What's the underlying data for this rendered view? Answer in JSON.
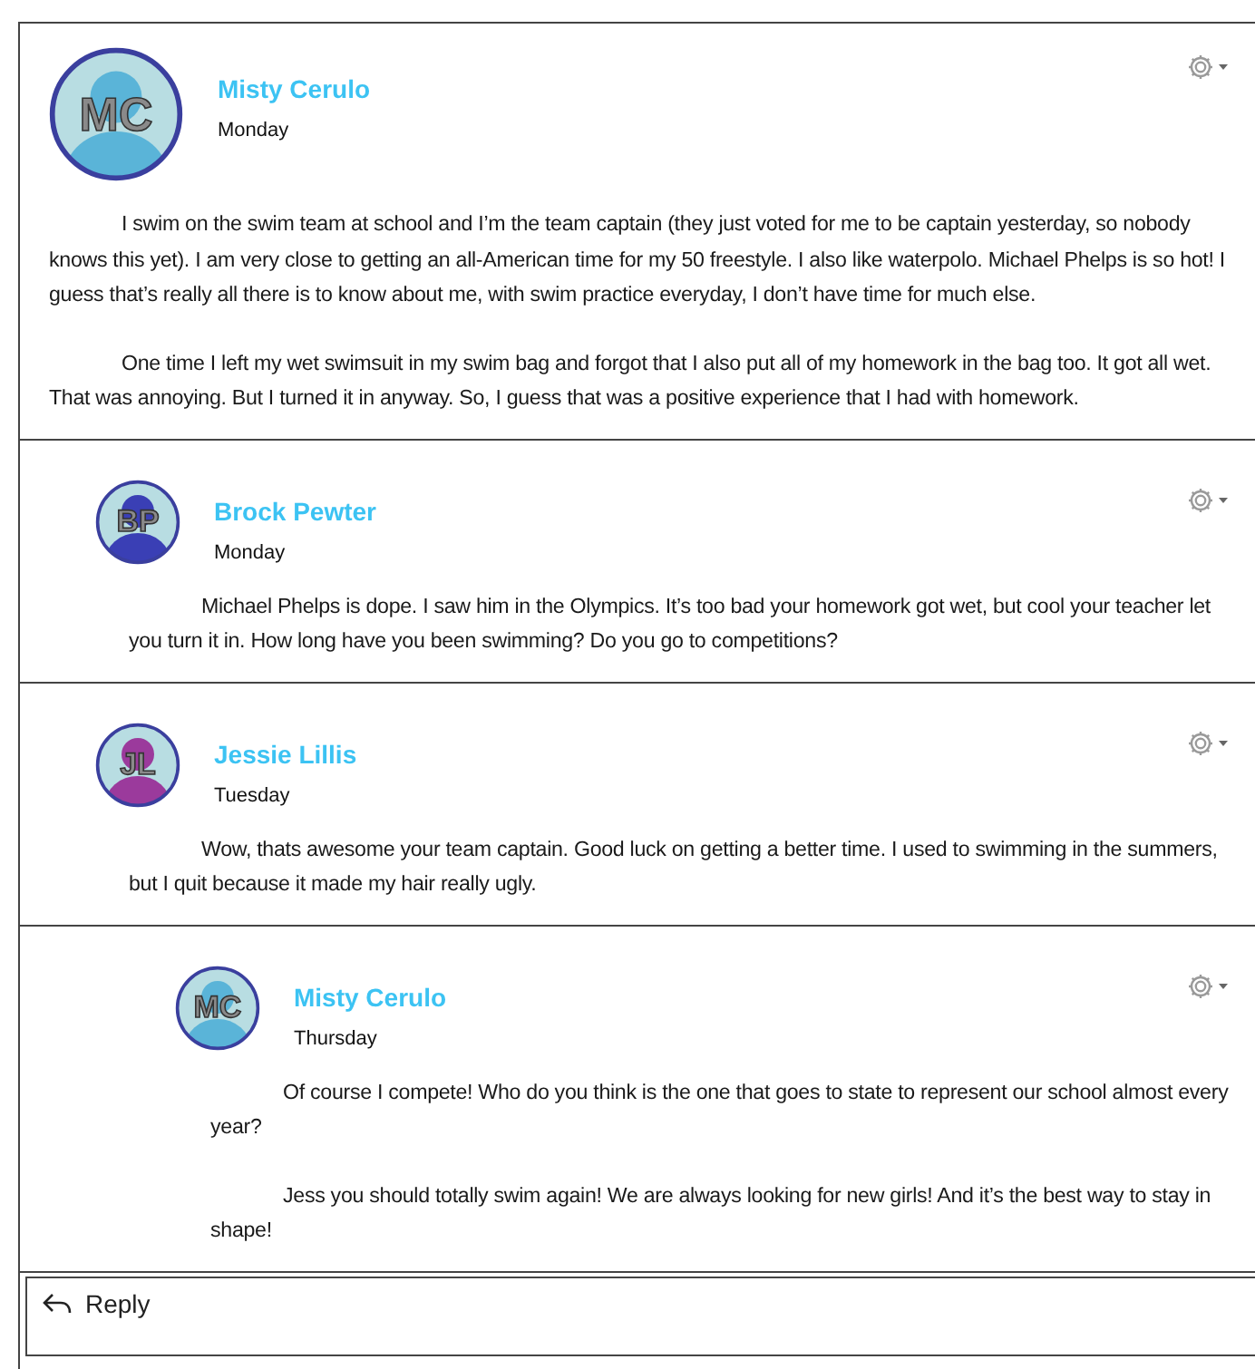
{
  "posts": [
    {
      "author": "Misty Cerulo",
      "initials": "MC",
      "color": "#5ab4d8",
      "day": "Monday",
      "paragraphs": [
        "I swim on the swim team at school and I’m the team captain (they just voted for me to be captain yesterday, so nobody knows this yet). I am very close to getting an all-American time for my 50 freestyle. I also like waterpolo. Michael Phelps is so hot! I guess that’s really all there is to know about me, with swim practice everyday, I don’t have time for much else.",
        "One time I left my wet swimsuit in my swim bag and forgot that I also put all of my homework in the bag too. It got all wet. That was annoying. But I turned it in anyway. So, I guess that was a positive experience that I had with homework."
      ],
      "children": [
        {
          "author": "Brock Pewter",
          "initials": "BP",
          "color": "#3a3fb5",
          "day": "Monday",
          "paragraphs": [
            "Michael Phelps is dope. I saw him in the Olympics. It’s too bad your homework got wet, but cool your teacher let you turn it in. How long have you been swimming? Do you go to competitions?"
          ]
        },
        {
          "author": "Jessie Lillis",
          "initials": "JL",
          "color": "#9b3a9c",
          "day": "Tuesday",
          "paragraphs": [
            "Wow, thats awesome your team captain.  Good luck on getting a better time. I used to swimming in the summers, but I quit because it made my hair really ugly."
          ],
          "children": [
            {
              "author": "Misty Cerulo",
              "initials": "MC",
              "color": "#5ab4d8",
              "day": "Thursday",
              "paragraphs": [
                "Of course I compete! Who do you think is the one that goes to state to represent our school almost every year?",
                "Jess you should totally swim again! We are always looking for new girls!  And it’s the best way to stay in shape!"
              ]
            }
          ]
        }
      ]
    }
  ],
  "reply": {
    "label": "Reply"
  }
}
